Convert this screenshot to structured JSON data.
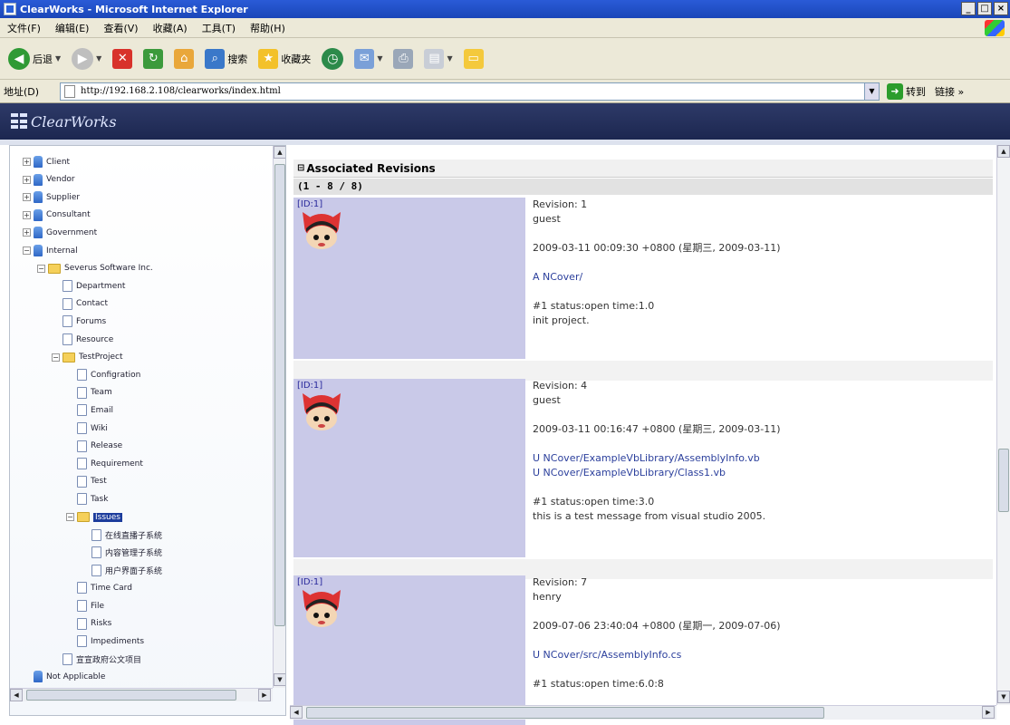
{
  "window": {
    "title": "ClearWorks - Microsoft Internet Explorer",
    "buttons": [
      "_",
      "□",
      "×"
    ]
  },
  "menu": [
    "文件(F)",
    "编辑(E)",
    "查看(V)",
    "收藏(A)",
    "工具(T)",
    "帮助(H)"
  ],
  "toolbar": {
    "back": "后退",
    "search": "搜索",
    "favorites": "收藏夹"
  },
  "address": {
    "label": "地址(D)",
    "url": "http://192.168.2.108/clearworks/index.html",
    "go": "转到",
    "links": "链接 »"
  },
  "app": {
    "logo": "ClearWorks"
  },
  "tree": [
    {
      "label": "Client",
      "icon": "person",
      "expander": "+"
    },
    {
      "label": "Vendor",
      "icon": "person",
      "expander": "+"
    },
    {
      "label": "Supplier",
      "icon": "person",
      "expander": "+"
    },
    {
      "label": "Consultant",
      "icon": "person",
      "expander": "+"
    },
    {
      "label": "Government",
      "icon": "person",
      "expander": "+"
    },
    {
      "label": "Internal",
      "icon": "person",
      "expander": "−"
    },
    {
      "label": "Severus Software Inc.",
      "icon": "folder",
      "expander": "−"
    },
    {
      "label": "Department",
      "icon": "doc"
    },
    {
      "label": "Contact",
      "icon": "doc"
    },
    {
      "label": "Forums",
      "icon": "doc"
    },
    {
      "label": "Resource",
      "icon": "doc"
    },
    {
      "label": "TestProject",
      "icon": "folder",
      "expander": "−"
    },
    {
      "label": "Configration",
      "icon": "doc"
    },
    {
      "label": "Team",
      "icon": "doc"
    },
    {
      "label": "Email",
      "icon": "doc"
    },
    {
      "label": "Wiki",
      "icon": "doc"
    },
    {
      "label": "Release",
      "icon": "doc"
    },
    {
      "label": "Requirement",
      "icon": "doc"
    },
    {
      "label": "Test",
      "icon": "doc"
    },
    {
      "label": "Task",
      "icon": "doc"
    },
    {
      "label": "Issues",
      "icon": "folder",
      "expander": "−",
      "selected": true
    },
    {
      "label": "在线直播子系统",
      "icon": "doc"
    },
    {
      "label": "内容管理子系统",
      "icon": "doc"
    },
    {
      "label": "用户界面子系统",
      "icon": "doc"
    },
    {
      "label": "Time Card",
      "icon": "doc"
    },
    {
      "label": "File",
      "icon": "doc"
    },
    {
      "label": "Risks",
      "icon": "doc"
    },
    {
      "label": "Impediments",
      "icon": "doc"
    },
    {
      "label": "宣宣政府公文项目",
      "icon": "doc"
    },
    {
      "label": "Not Applicable",
      "icon": "person"
    }
  ],
  "content": {
    "section_title": "Associated Revisions",
    "count": "(1 - 8 / 8)",
    "revisions": [
      {
        "id": "[ID:1]",
        "lines": [
          "Revision: 1",
          "guest",
          "",
          "2009-03-11 00:09:30 +0800 (星期三, 2009-03-11)",
          "",
          "A NCover/",
          "",
          "#1 status:open time:1.0",
          "init project."
        ]
      },
      {
        "id": "[ID:1]",
        "lines": [
          "Revision: 4",
          "guest",
          "",
          "2009-03-11 00:16:47 +0800 (星期三, 2009-03-11)",
          "",
          "U NCover/ExampleVbLibrary/AssemblyInfo.vb",
          "U NCover/ExampleVbLibrary/Class1.vb",
          "",
          "#1 status:open time:3.0",
          "this is a test message from visual studio 2005."
        ]
      },
      {
        "id": "[ID:1]",
        "lines": [
          "Revision: 7",
          "henry",
          "",
          "2009-07-06 23:40:04 +0800 (星期一, 2009-07-06)",
          "",
          "U NCover/src/AssemblyInfo.cs",
          "",
          "#1 status:open time:6.0:8"
        ]
      }
    ]
  }
}
